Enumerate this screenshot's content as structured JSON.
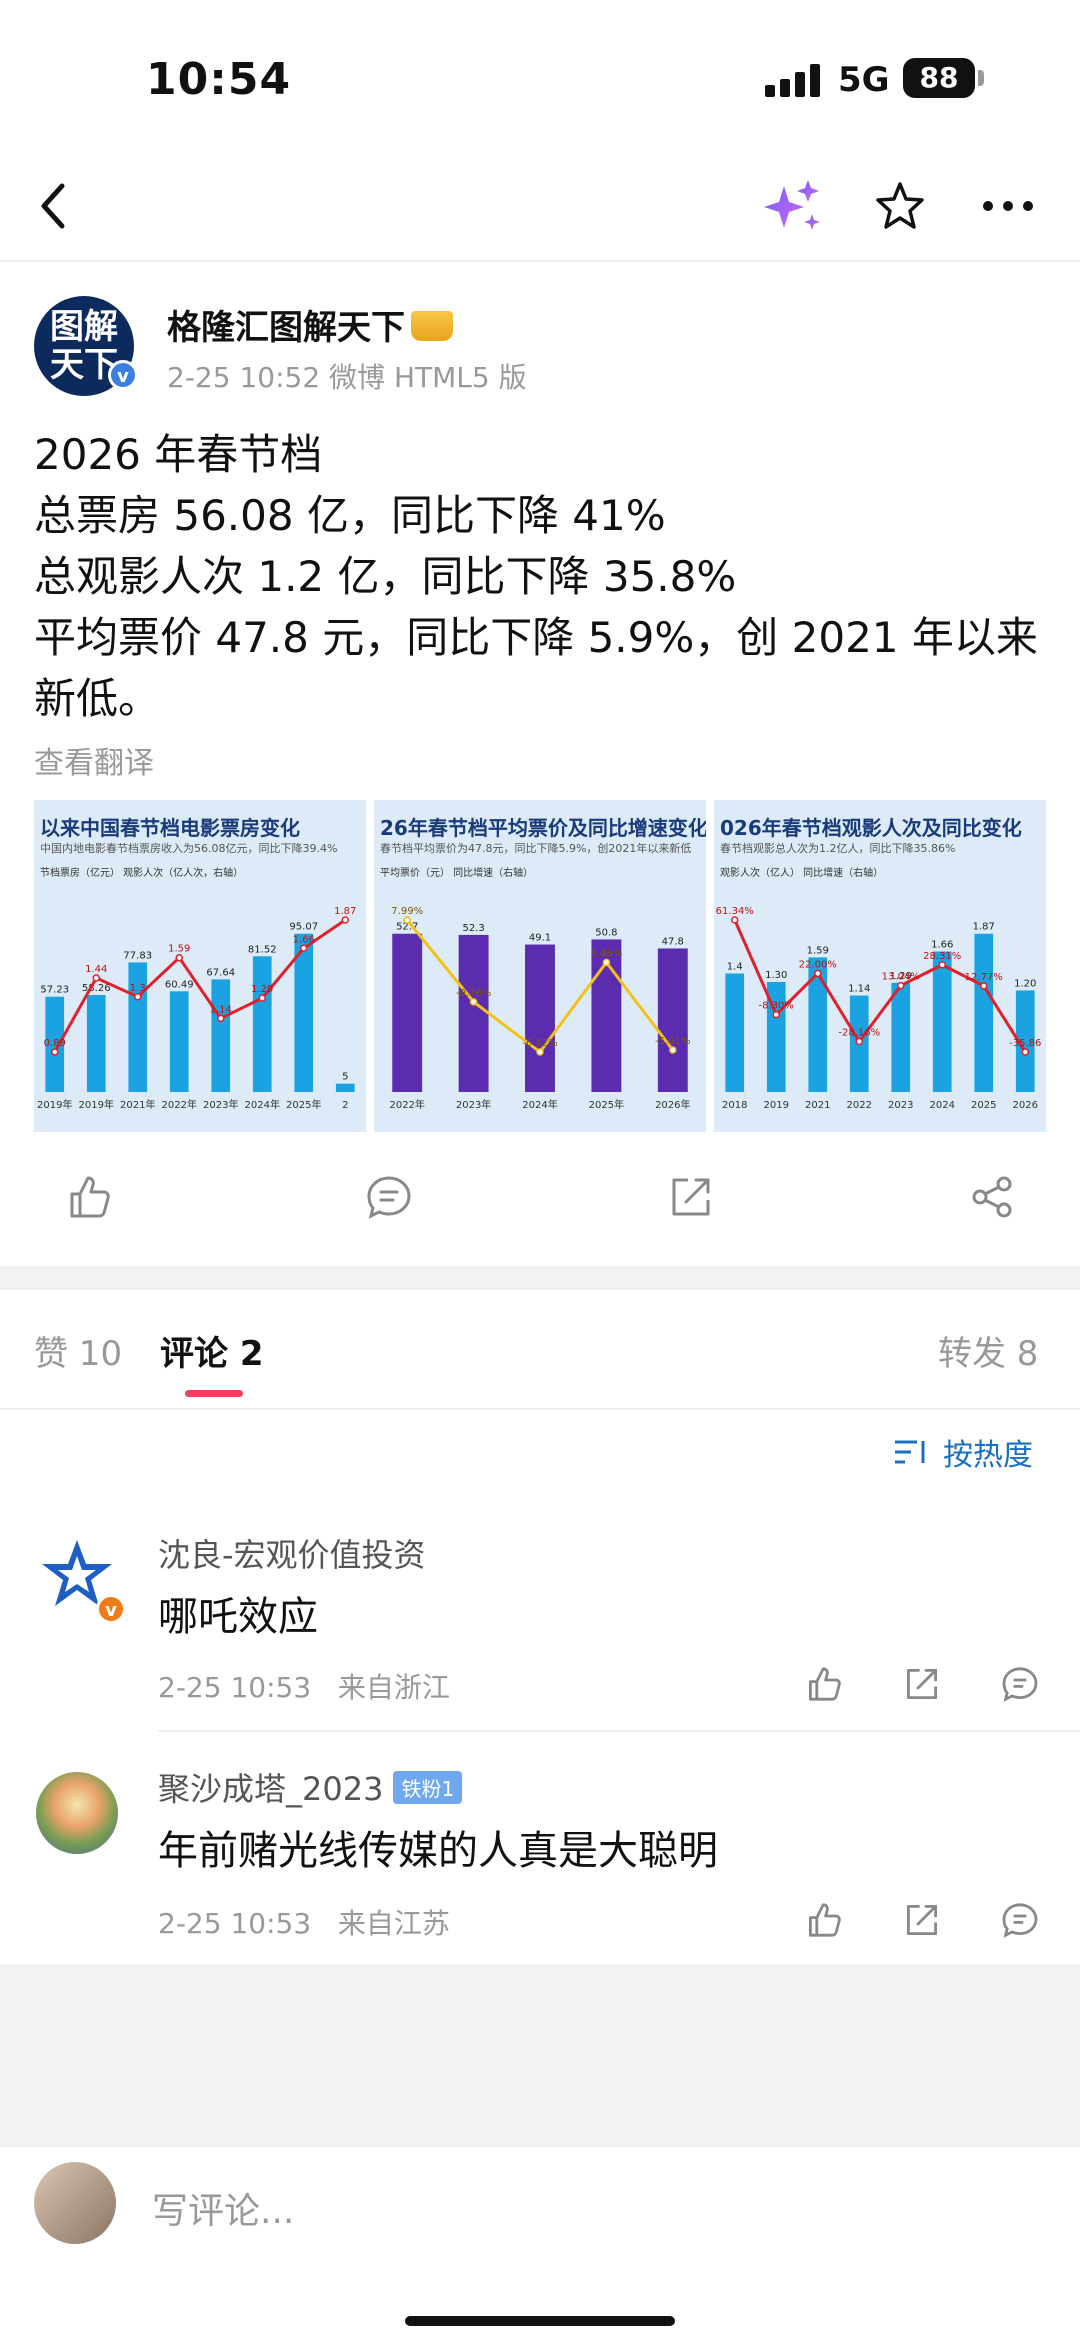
{
  "status": {
    "time": "10:54",
    "network": "5G",
    "battery": "88"
  },
  "post": {
    "author": "格隆汇图解天下",
    "meta": "2-25 10:52  微博 HTML5 版",
    "lines": [
      "2026 年春节档",
      "总票房 56.08 亿，同比下降 41%",
      "总观影人次 1.2 亿，同比下降 35.8%",
      "平均票价 47.8 元，同比下降 5.9%，创 2021 年以来",
      "新低。"
    ],
    "translate": "查看翻译",
    "images": [
      {
        "title": "以来中国春节档电影票房变化",
        "sub": "中国内地电影春节档票房收入为56.08亿元，同比下降39.4%",
        "legend": "节档票房（亿元）   观影人次（亿人次，右轴）",
        "years": [
          "2019年",
          "2019年",
          "2021年",
          "2022年",
          "2023年",
          "2024年",
          "2025年",
          "2"
        ],
        "values": [
          "57.23",
          "58.26",
          "77.83",
          "60.49",
          "67.64",
          "81.52",
          "95.07",
          "5"
        ],
        "lineLabels": [
          "0.89",
          "1.44",
          "1.3",
          "1.59",
          "1.14",
          "1.29",
          "1.66",
          "1.87"
        ]
      },
      {
        "title": "26年春节档平均票价及同比增速变化",
        "sub": "春节档平均票价为47.8元，同比下降5.9%，创2021年以来新低",
        "legend": "平均票价（元）  同比增速（右轴）",
        "years": [
          "2022年",
          "2023年",
          "2024年",
          "2025年",
          "2026年"
        ],
        "values": [
          "52.7",
          "52.3",
          "49.1",
          "50.8",
          "47.8"
        ],
        "lineLabels": [
          "7.99%",
          "-0.76%",
          "-6.12%",
          "3.46%",
          "-5.91%"
        ]
      },
      {
        "title": "026年春节档观影人次及同比变化",
        "sub": "春节档观影总人次为1.2亿人，同比下降35.86%",
        "legend": "观影人次（亿人）   同比增速（右轴）",
        "years": [
          "2018",
          "2019",
          "2021",
          "2022",
          "2023",
          "2024",
          "2025",
          "2026"
        ],
        "values": [
          "1.4",
          "1.30",
          "1.59",
          "1.14",
          "1.29",
          "1.66",
          "1.87",
          "1.20"
        ],
        "lineLabels": [
          "61.34%",
          "-8.30%",
          "22.00%",
          "-28.16%",
          "13.04%",
          "28.31%",
          "12.77%",
          "-35.86"
        ]
      }
    ]
  },
  "tabs": {
    "likes": "赞 10",
    "comments": "评论 2",
    "reposts": "转发 8"
  },
  "sort": {
    "label": "按热度"
  },
  "comments": [
    {
      "name": "沈良-宏观价值投资",
      "text": "哪吒效应",
      "time": "2-25 10:53",
      "location": "来自浙江"
    },
    {
      "name": "聚沙成塔_2023",
      "badge": "铁粉1",
      "text": "年前赌光线传媒的人真是大聪明",
      "time": "2-25 10:53",
      "location": "来自江苏"
    }
  ],
  "input": {
    "placeholder": "写评论..."
  },
  "colors": {
    "accent": "#f0405f",
    "link": "#1b6fc1",
    "verified": "#f07b1b"
  }
}
